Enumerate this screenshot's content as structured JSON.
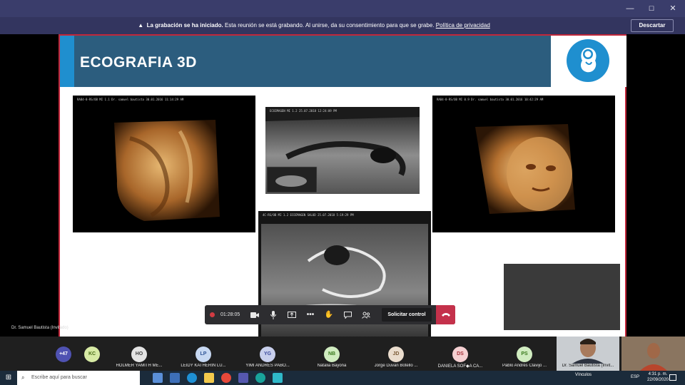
{
  "window": {
    "minimize": "—",
    "maximize": "☐",
    "close": "✕"
  },
  "recording": {
    "title": "La grabación se ha iniciado.",
    "message": "Esta reunión se está grabando. Al unirse, da su consentimiento para que se grabe.",
    "link": "Política de privacidad",
    "dismiss": "Descartar"
  },
  "slide": {
    "title": "ECOGRAFIA 3D"
  },
  "ultrasound_headers": [
    "RAB4-8-RS/OB  MI 1.1  Dr. samuel bautista  30.01.2016 11:14:29 AM",
    "ECOIMAGEN  MI 1.2  25.07.2018  12:24:09 PM",
    "RAB4-8-RS/OB  MI 0.9  Dr. samuel bautista  30.01.2016 10:42:29 AM",
    "4C-RS/OB  MI 1.2  ECOIMAGEN SALUD  25.07.2018  5:19:29 PM"
  ],
  "presenter": {
    "name": "Dr. Samuel Bautista (Invitado)"
  },
  "controls": {
    "timer": "01:28:05",
    "take_control": "Solicitar control",
    "icons": [
      "camera-icon",
      "mic-icon",
      "share-icon",
      "more-icon",
      "raise-hand-icon",
      "chat-icon",
      "participants-icon"
    ]
  },
  "participants": {
    "more_count": "+47",
    "list": [
      {
        "initials": "KC",
        "name": "",
        "color": "#d7eaa4",
        "text": "#476b14"
      },
      {
        "initials": "HO",
        "name": "HOLMER YAMITH ME...",
        "color": "#e3e3e3",
        "text": "#444444"
      },
      {
        "initials": "LP",
        "name": "LEIDY KATHERIN LU...",
        "color": "#c7d8f2",
        "text": "#2f5597"
      },
      {
        "initials": "YG",
        "name": "YIMI ANDRES PABO...",
        "color": "#c8cfec",
        "text": "#3b4a9c"
      },
      {
        "initials": "NB",
        "name": "Natalia Bayona",
        "color": "#d0ecc0",
        "text": "#3a7a1d"
      },
      {
        "initials": "JD",
        "name": "Jorge Duvan Botello ...",
        "color": "#eadccd",
        "text": "#7a5a35"
      },
      {
        "initials": "DS",
        "name": "DANIELA SOF◆A CA...",
        "color": "#f5d0d2",
        "text": "#a6333b"
      },
      {
        "initials": "PS",
        "name": "Pablo Andrés Clavijo ...",
        "color": "#d0ecc0",
        "text": "#3a7a1d"
      }
    ],
    "video": {
      "name": "Dr. Samuel Bautista (Invit..."
    }
  },
  "taskbar": {
    "search_placeholder": "Escribe aquí para buscar",
    "tray_label": "Vínculos",
    "language": "ESP",
    "time": "4:31 p. m.",
    "date": "22/09/2020"
  }
}
